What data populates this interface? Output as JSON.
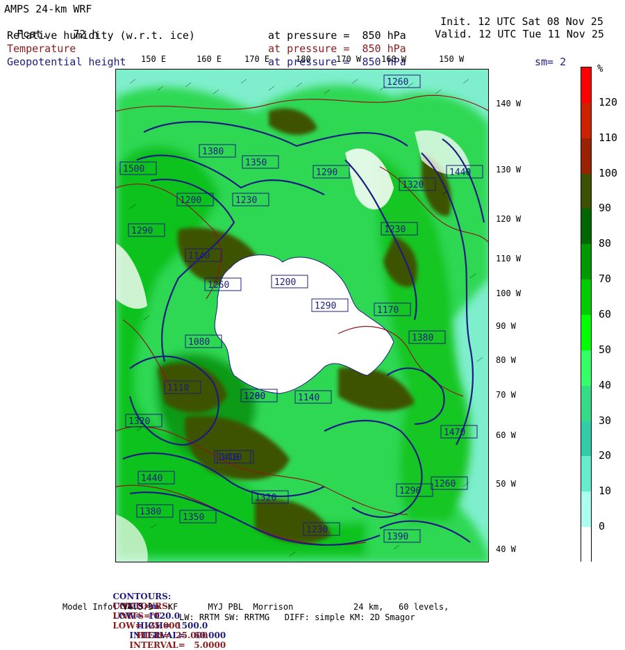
{
  "header": {
    "model_title": "AMPS 24-km WRF",
    "fcst_label": "Fcst.",
    "fcst_value": "72 h",
    "init_label": "Init.",
    "init_value": "12 UTC Sat 08 Nov 25",
    "valid_label": "Valid.",
    "valid_value": "12 UTC Tue 11 Nov 25",
    "fields": [
      {
        "name": "Relative humidity (w.r.t. ice)",
        "level": "at pressure =  850 hPa",
        "color": "#000000"
      },
      {
        "name": "Temperature",
        "level": "at pressure =  850 hPa",
        "color": "#8b1a1a"
      },
      {
        "name": "Geopotential height",
        "level": "at pressure =  850 hPa",
        "color": "#1c1c80"
      }
    ],
    "smoothing": "sm= 2"
  },
  "longitude_labels": [
    "150 E",
    "160 E",
    "170 E",
    "180",
    "170 W",
    "160 W",
    "150 W"
  ],
  "latitude_labels": [
    "140 W",
    "130 W",
    "120 W",
    "110 W",
    "100 W",
    "90 W",
    "80 W",
    "70 W",
    "60 W",
    "50 W",
    "40 W"
  ],
  "colorbar": {
    "unit": "%",
    "ticks": [
      "120",
      "110",
      "100",
      "90",
      "80",
      "70",
      "60",
      "50",
      "40",
      "30",
      "20",
      "10",
      "0"
    ],
    "colors": [
      "#ff0000",
      "#cc2200",
      "#992200",
      "#3d5200",
      "#006600",
      "#009900",
      "#00cc00",
      "#00ff00",
      "#33ff66",
      "#33dd88",
      "#33ccaa",
      "#66eecc",
      "#aaffee",
      "#ffffff"
    ]
  },
  "height_labels": [
    "1500",
    "1380",
    "1350",
    "1290",
    "1440",
    "1260",
    "1320",
    "1200",
    "1230",
    "1290",
    "1140",
    "1080",
    "1110",
    "1320",
    "1260",
    "1200",
    "1290",
    "1170",
    "1230",
    "1380",
    "1260",
    "1140",
    "1410",
    "1200",
    "1320",
    "1390",
    "1440",
    "1410",
    "1380",
    "1350",
    "1230",
    "1470",
    "1290",
    "1260"
  ],
  "map_features": {
    "ice_color": "#ffffff",
    "rh_color_light": "#66eecc",
    "rh_color_mid": "#00cc00",
    "rh_color_high": "#3d5200",
    "height_contour_color": "#1c1c80",
    "temperature_contour_color": "#8b1a1a"
  },
  "footer": {
    "contours_height": {
      "label": "CONTOURS:",
      "units": "UNITS=m",
      "low": "LOW=  1020.0",
      "high": "HIGH=  1500.0",
      "interval": "INTERVAL=   60.000",
      "color": "#1c1c80"
    },
    "contours_temp": {
      "label": "CONTOURS:",
      "units": "UNITS=°C",
      "low": "LOW= -25.000",
      "high": "HIGH=  25.000",
      "interval": "INTERVAL=   5.0000",
      "color": "#8b1a1a"
    },
    "model_info_line1": "Model Info: V4.3.3   KF      MYJ PBL  Morrison            24 km,   60 levels,",
    "model_info_line2": "LW: RRTM SW: RRTMG   DIFF: simple KM: 2D Smagor"
  }
}
